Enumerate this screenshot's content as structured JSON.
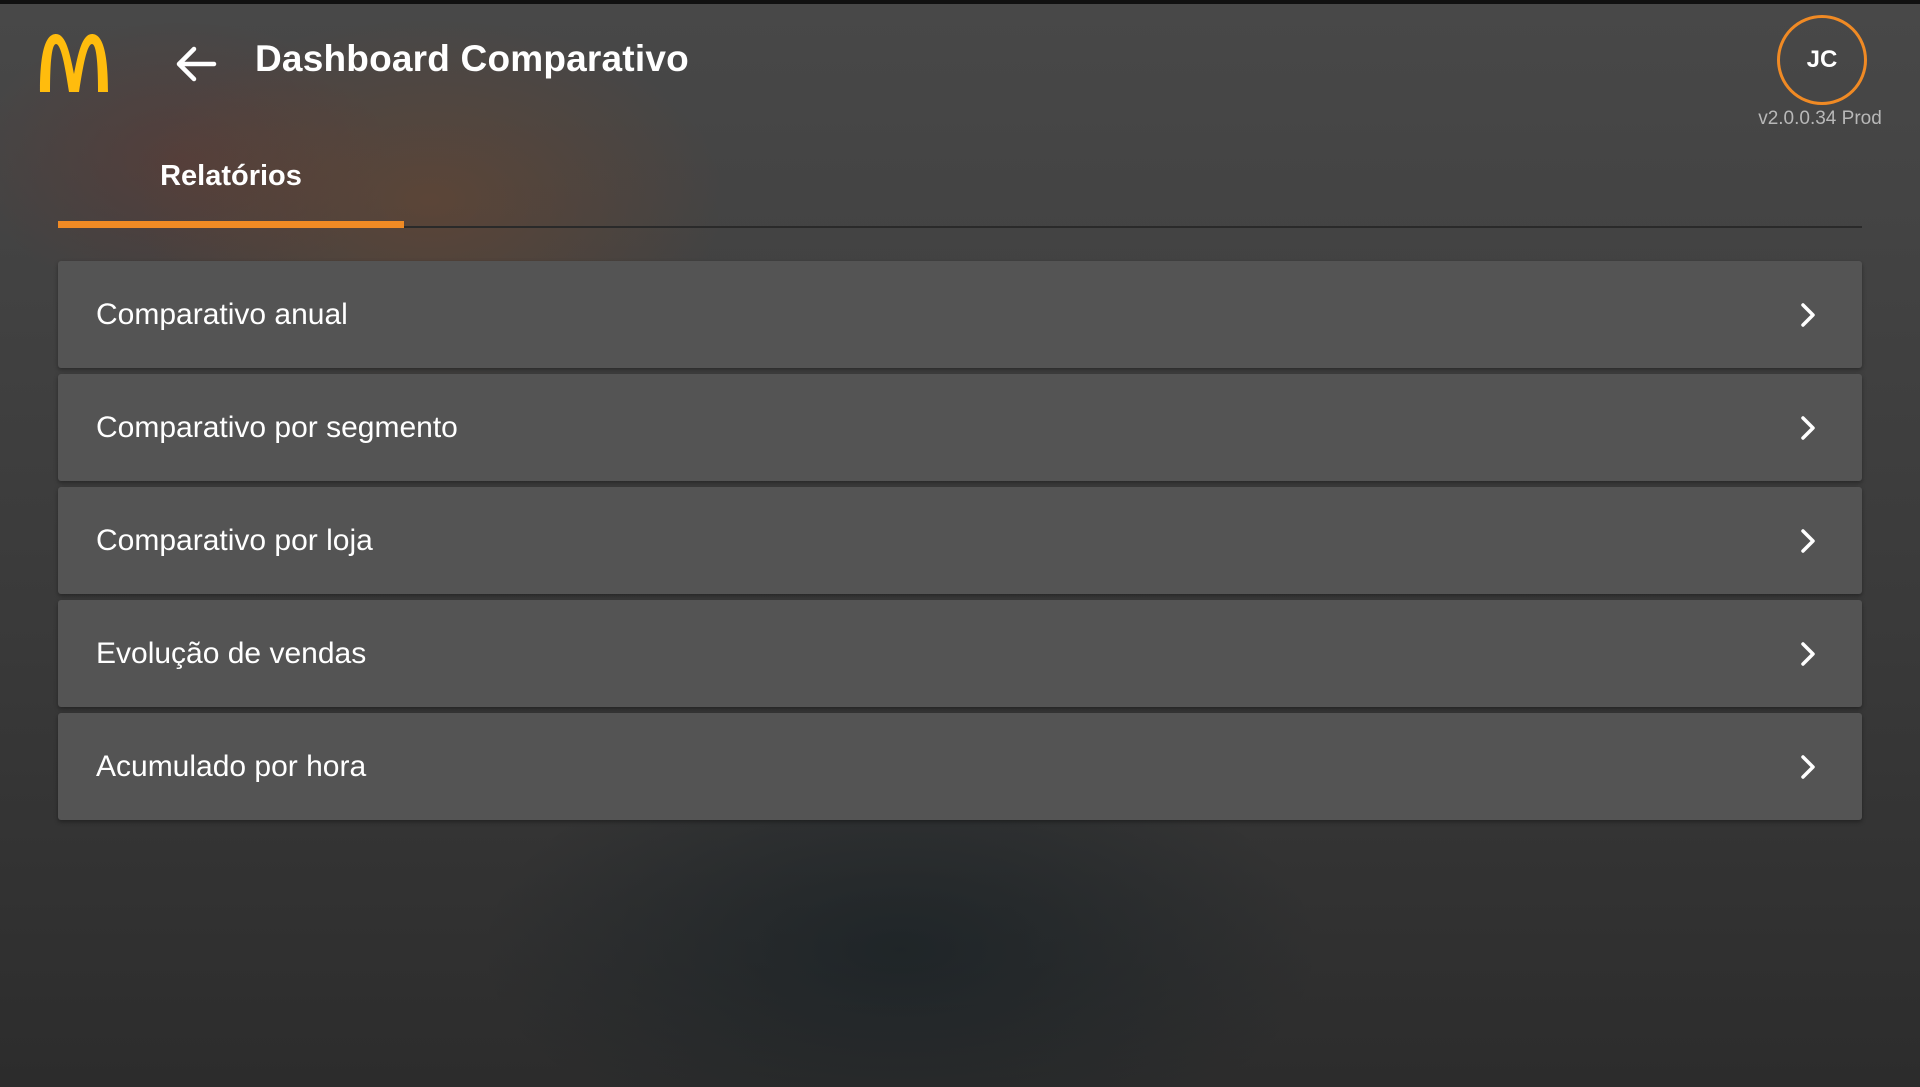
{
  "app": {
    "title": "Dashboard Comparativo",
    "version": "v2.0.0.34 Prod",
    "accent_color": "#f08a24",
    "logo_color": "#ffbc0d"
  },
  "header": {
    "logo_icon": "mcdonalds-logo",
    "back_icon": "arrow-left-icon",
    "avatar_initials": "JC"
  },
  "tabs": [
    {
      "label": "Relatórios",
      "selected": true
    }
  ],
  "reports": [
    {
      "label": "Comparativo anual",
      "icon": "chevron-right-icon"
    },
    {
      "label": "Comparativo por segmento",
      "icon": "chevron-right-icon"
    },
    {
      "label": "Comparativo por loja",
      "icon": "chevron-right-icon"
    },
    {
      "label": "Evolução de vendas",
      "icon": "chevron-right-icon"
    },
    {
      "label": "Acumulado por hora",
      "icon": "chevron-right-icon"
    }
  ]
}
